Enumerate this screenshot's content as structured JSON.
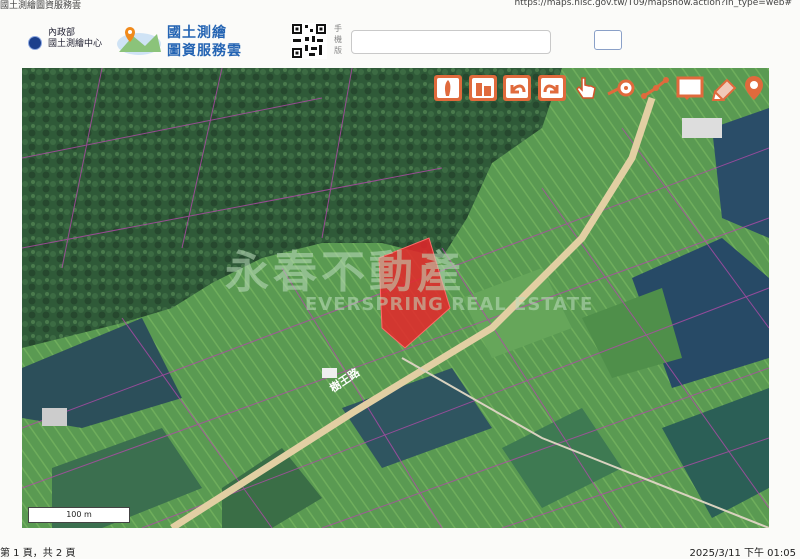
{
  "print_header": {
    "left_text": "國土測繪圖資服務雲",
    "right_text": "https://maps.nlsc.gov.tw/T09/mapshow.action?In_type=web#"
  },
  "header": {
    "ministry_text": "內政部",
    "center_text": "國土測繪中心",
    "brand_line1": "國土測繪",
    "brand_line2": "圖資服務雲",
    "mobile_label": "手機版"
  },
  "search": {
    "placeholder": "",
    "value": ""
  },
  "toolbar": {
    "icons": [
      "taiwan-map-icon",
      "building-icon",
      "undo-icon",
      "redo-icon",
      "pointer-hand-icon",
      "measure-point-icon",
      "measure-line-icon",
      "measure-area-icon",
      "eraser-icon",
      "pin-icon"
    ]
  },
  "map": {
    "watermark_main": "永春不動產",
    "watermark_sub": "EVERSPRING REAL ESTATE",
    "road_label": "樹王路",
    "highlight_color": "#e8262a"
  },
  "scale_bar": {
    "label": "100 m"
  },
  "print_footer": {
    "page_text": "第 1 頁，共 2 頁",
    "datetime_text": "2025/3/11 下午 01:05"
  }
}
